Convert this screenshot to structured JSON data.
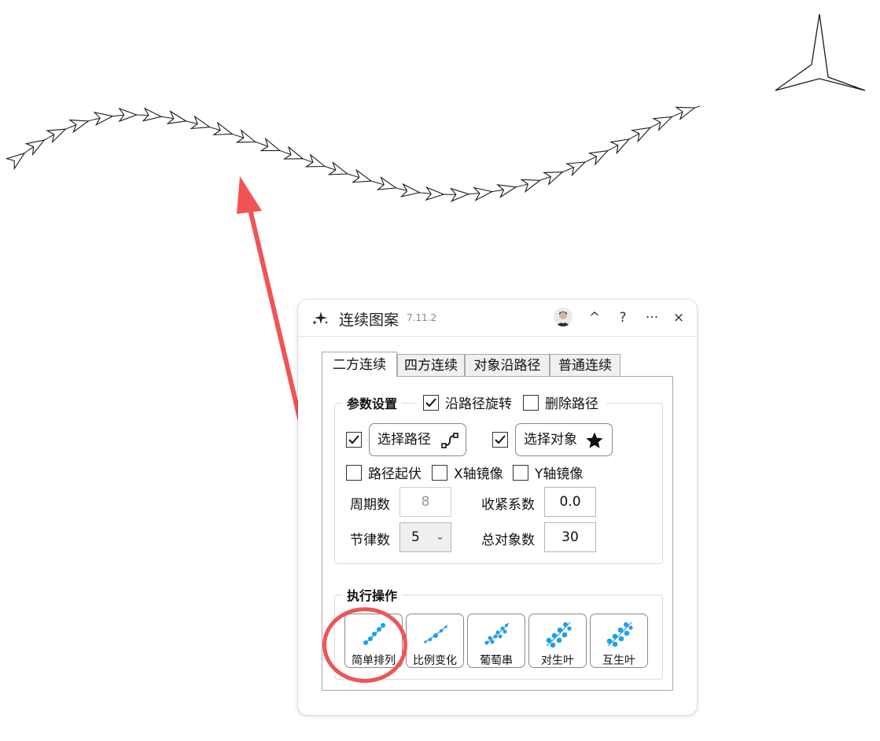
{
  "window": {
    "title": "连续图案",
    "version": "7.11.2",
    "controls": {
      "collapse": "^",
      "help": "?",
      "more": "···",
      "close": "×"
    }
  },
  "tabs": [
    {
      "label": "二方连续",
      "active": true
    },
    {
      "label": "四方连续",
      "active": false
    },
    {
      "label": "对象沿路径",
      "active": false
    },
    {
      "label": "普通连续",
      "active": false
    }
  ],
  "params": {
    "title": "参数设置",
    "rotate_along_path": {
      "label": "沿路径旋转",
      "checked": true
    },
    "delete_path": {
      "label": "删除路径",
      "checked": false
    },
    "select_path": {
      "label": "选择路径",
      "checked": true,
      "icon": "path-icon"
    },
    "select_object": {
      "label": "选择对象",
      "checked": true,
      "icon": "star-icon"
    },
    "path_undulation": {
      "label": "路径起伏",
      "checked": false
    },
    "x_mirror": {
      "label": "X轴镜像",
      "checked": false
    },
    "y_mirror": {
      "label": "Y轴镜像",
      "checked": false
    },
    "period": {
      "label": "周期数",
      "value": "8",
      "disabled": true
    },
    "tighten": {
      "label": "收紧系数",
      "value": "0.0"
    },
    "rhythm": {
      "label": "节律数",
      "value": "5"
    },
    "total_objects": {
      "label": "总对象数",
      "value": "30"
    }
  },
  "actions": {
    "title": "执行操作",
    "items": [
      {
        "label": "简单排列",
        "icon": "simple-arrange-icon"
      },
      {
        "label": "比例变化",
        "icon": "scale-change-icon"
      },
      {
        "label": "葡萄串",
        "icon": "grape-cluster-icon"
      },
      {
        "label": "对生叶",
        "icon": "opposite-leaf-icon"
      },
      {
        "label": "互生叶",
        "icon": "alternate-leaf-icon"
      }
    ]
  },
  "colors": {
    "accent_blue": "#1ea0e6",
    "annotation_red": "#f05454",
    "stroke": "#1a1a1a"
  }
}
